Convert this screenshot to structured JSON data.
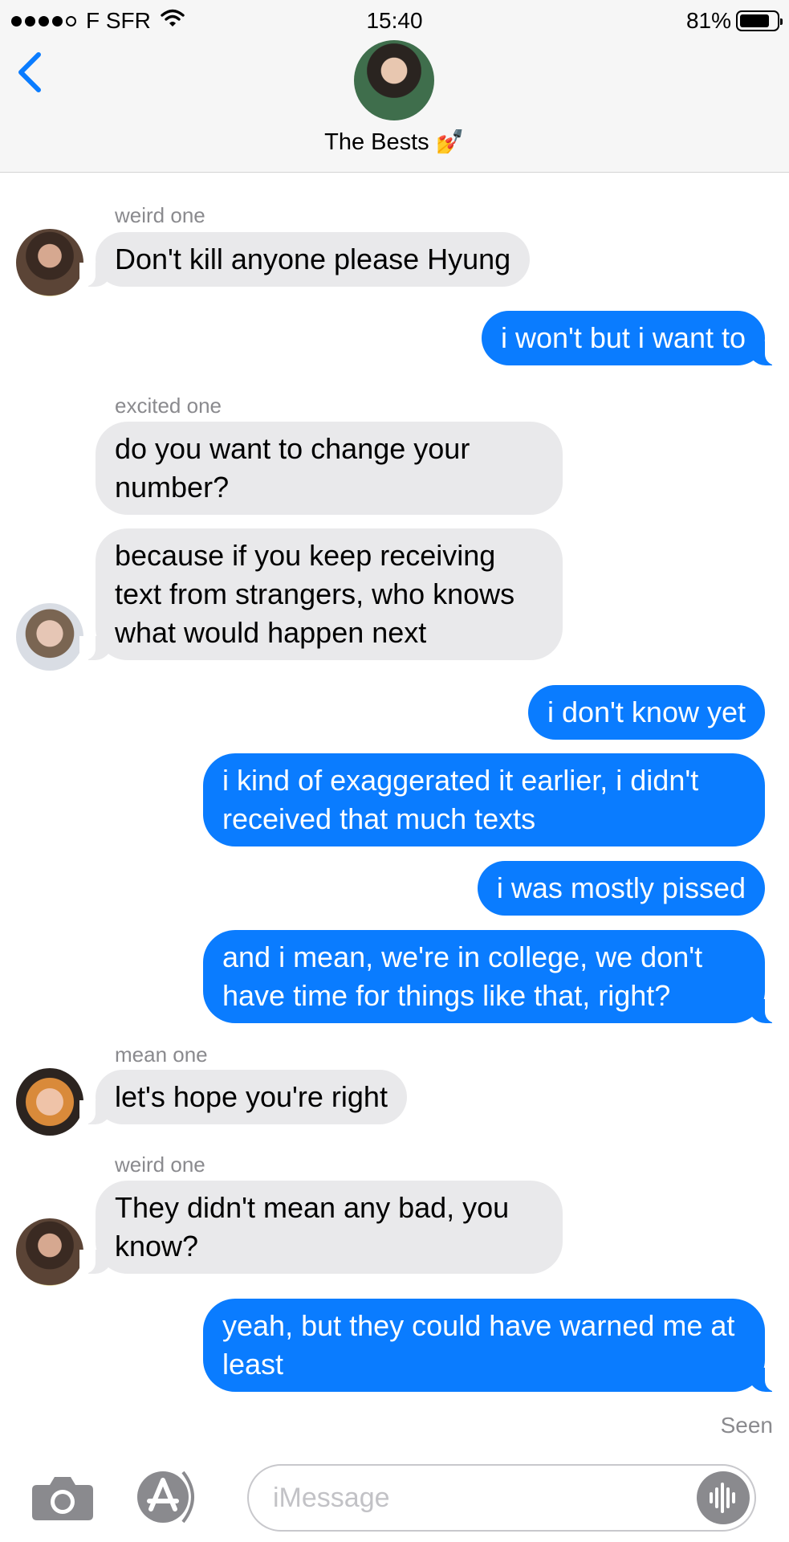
{
  "status_bar": {
    "carrier": "F SFR",
    "time": "15:40",
    "battery": "81%",
    "battery_level": 0.81,
    "signal_bars": 4,
    "signal_bars_total": 5
  },
  "header": {
    "group_name": "The Bests 💅"
  },
  "messages": [
    {
      "sender": "weird one",
      "text": "Don't kill anyone please Hyung"
    },
    {
      "text": "i won't but i want to"
    },
    {
      "sender": "excited one",
      "text": "do you want to change your number?"
    },
    {
      "text": "because if you keep receiving text from strangers, who knows what would happen next"
    },
    {
      "text": "i don't know yet"
    },
    {
      "text": "i kind of exaggerated it earlier, i didn't received that much texts"
    },
    {
      "text": "i was mostly pissed"
    },
    {
      "text": "and i mean, we're in college, we don't have time for things like that, right?"
    },
    {
      "sender": "mean one",
      "text": "let's hope you're right"
    },
    {
      "sender": "weird one",
      "text": "They didn't mean any bad, you know?"
    },
    {
      "text": "yeah, but they could have warned me at least"
    }
  ],
  "seen_label": "Seen",
  "input": {
    "placeholder": "iMessage",
    "value": ""
  },
  "colors": {
    "outgoing_bubble": "#0a7cff",
    "incoming_bubble": "#e9e9eb",
    "accent": "#0a7cff",
    "meta_text": "#8a8a8e"
  },
  "icons": [
    "back-chevron-icon",
    "wifi-icon",
    "camera-icon",
    "app-store-icon",
    "audio-message-icon"
  ]
}
